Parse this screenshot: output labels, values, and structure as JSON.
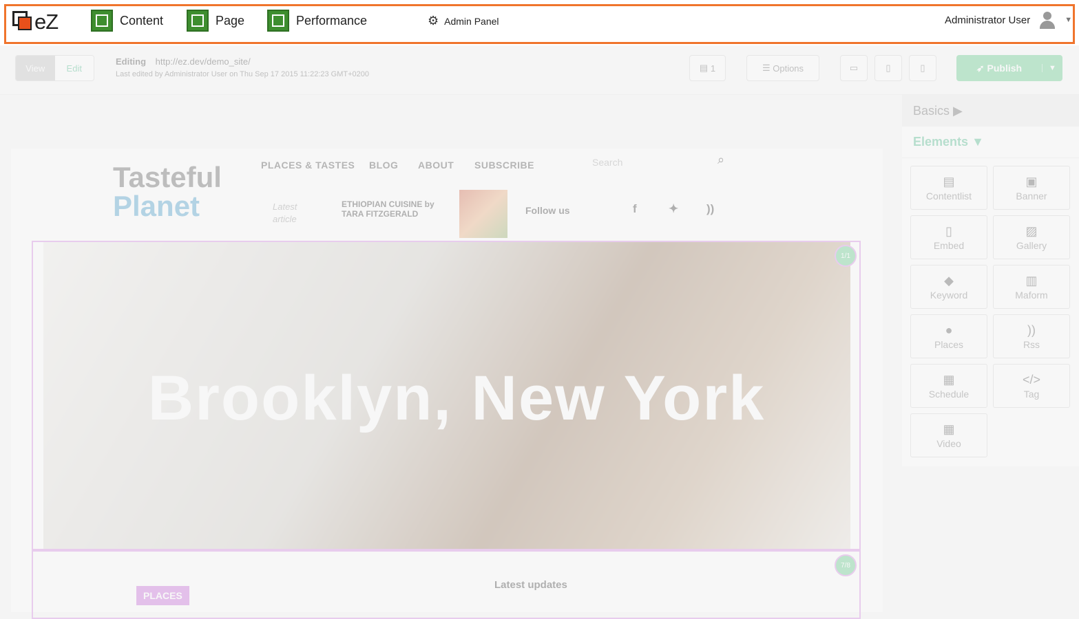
{
  "topbar": {
    "logo_text": "eZ",
    "nav": [
      {
        "label": "Content",
        "icon": "content-icon"
      },
      {
        "label": "Page",
        "icon": "page-icon"
      },
      {
        "label": "Performance",
        "icon": "performance-icon"
      }
    ],
    "admin_label": "Admin Panel",
    "user_name": "Administrator User"
  },
  "toolbar": {
    "view_label": "View",
    "edit_label": "Edit",
    "editing_label": "Editing",
    "editing_url": "http://ez.dev/demo_site/",
    "last_edited": "Last edited by Administrator User on Thu Sep 17 2015 11:22:23 GMT+0200",
    "drafts_count": "1",
    "options_label": "Options",
    "publish_label": "Publish"
  },
  "site": {
    "brand_line1": "Tasteful",
    "brand_line2": "Planet",
    "nav": [
      "PLACES & TASTES",
      "BLOG",
      "ABOUT",
      "SUBSCRIBE"
    ],
    "search_placeholder": "Search",
    "latest_label": "Latest article",
    "article_title": "ETHIOPIAN CUISINE by TARA FITZGERALD",
    "follow_label": "Follow us",
    "hero_title": "Brooklyn, New York",
    "hero_pager": "1/1",
    "block2_pager": "7/8",
    "places_tag": "PLACES",
    "latest_updates": "Latest updates"
  },
  "sidebar": {
    "basics_label": "Basics",
    "elements_label": "Elements",
    "tiles": [
      {
        "label": "Contentlist",
        "icon": "contentlist-icon"
      },
      {
        "label": "Banner",
        "icon": "banner-icon"
      },
      {
        "label": "Embed",
        "icon": "embed-icon"
      },
      {
        "label": "Gallery",
        "icon": "gallery-icon"
      },
      {
        "label": "Keyword",
        "icon": "keyword-icon"
      },
      {
        "label": "Maform",
        "icon": "maform-icon"
      },
      {
        "label": "Places",
        "icon": "places-icon"
      },
      {
        "label": "Rss",
        "icon": "rss-icon"
      },
      {
        "label": "Schedule",
        "icon": "schedule-icon"
      },
      {
        "label": "Tag",
        "icon": "tag-icon"
      },
      {
        "label": "Video",
        "icon": "video-icon"
      }
    ]
  }
}
